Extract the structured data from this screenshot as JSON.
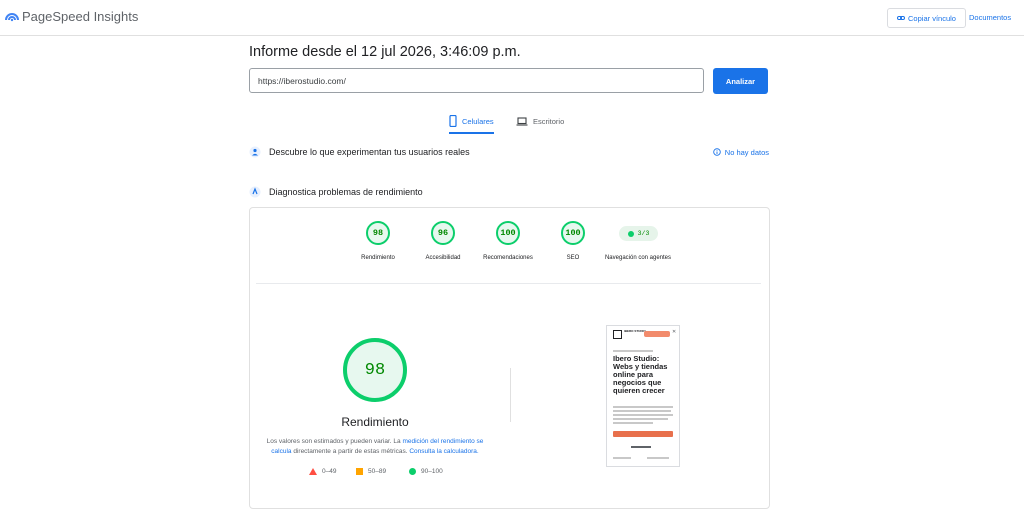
{
  "header": {
    "app_title": "PageSpeed Insights",
    "copy_link_label": "Copiar vínculo",
    "docs_label": "Documentos"
  },
  "report": {
    "title": "Informe desde el 12 jul 2026, 3:46:09 p.m.",
    "url_value": "https://iberostudio.com/",
    "analyze_label": "Analizar"
  },
  "tabs": [
    {
      "label": "Celulares",
      "active": true,
      "icon": "smartphone-icon"
    },
    {
      "label": "Escritorio",
      "active": false,
      "icon": "laptop-icon"
    }
  ],
  "field_section": {
    "label": "Descubre lo que experimentan tus usuarios reales",
    "status": "No hay datos"
  },
  "lab_section": {
    "label": "Diagnostica problemas de rendimiento"
  },
  "scores": [
    {
      "value": "98",
      "label": "Rendimiento"
    },
    {
      "value": "96",
      "label": "Accesibilidad"
    },
    {
      "value": "100",
      "label": "Recomendaciones"
    },
    {
      "value": "100",
      "label": "SEO"
    }
  ],
  "agent_nav": {
    "value": "3/3",
    "label": "Navegación con agentes"
  },
  "performance": {
    "score": "98",
    "label": "Rendimiento",
    "note_prefix": "Los valores son estimados y pueden variar. La",
    "note_link1": "medición del rendimiento se calcula",
    "note_middle": "directamente a partir de estas métricas.",
    "note_link2": "Consulta la calculadora."
  },
  "legend": [
    {
      "range": "0–49",
      "color": "#ff4e42"
    },
    {
      "range": "50–89",
      "color": "#ffa400"
    },
    {
      "range": "90–100",
      "color": "#0cce6b"
    }
  ],
  "preview": {
    "brand": "IBERO STUDIO",
    "headline": "Ibero Studio: Webs y tiendas online para negocios que quieren crecer"
  },
  "colors": {
    "accent": "#1a73e8",
    "pass": "#0cce6b",
    "average": "#ffa400",
    "fail": "#ff4e42"
  }
}
